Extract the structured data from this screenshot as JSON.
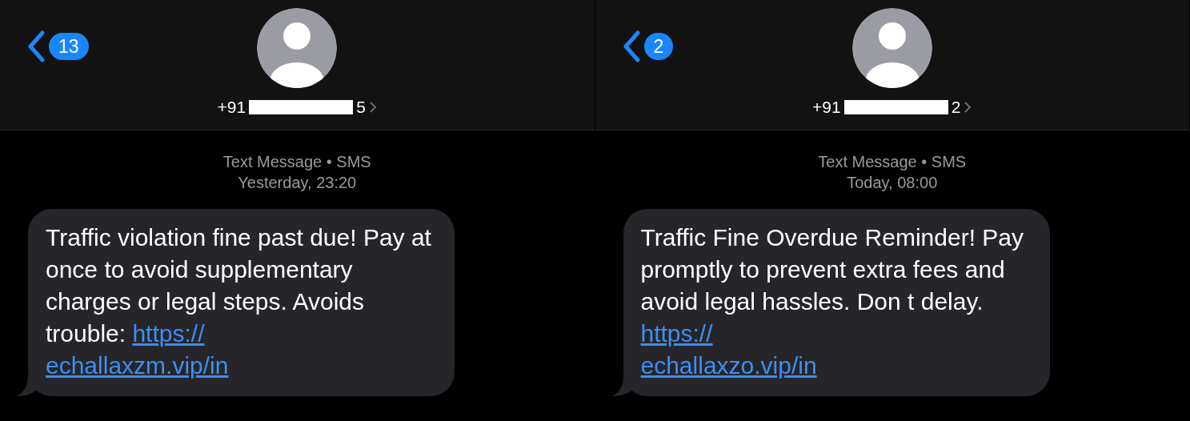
{
  "screens": [
    {
      "back_badge": "13",
      "contact": {
        "prefix": "+91",
        "suffix": "5"
      },
      "meta": {
        "service": "Text Message • SMS",
        "time": "Yesterday, 23:20"
      },
      "message": {
        "text": "Traffic violation fine past due! Pay at once to avoid supplementary charges or legal steps. Avoids trouble:",
        "link": [
          "https://",
          "echallaxzm.vip/in"
        ]
      }
    },
    {
      "back_badge": "2",
      "contact": {
        "prefix": "+91",
        "suffix": "2"
      },
      "meta": {
        "service": "Text Message • SMS",
        "time": "Today, 08:00"
      },
      "message": {
        "text": "Traffic Fine Overdue Reminder! Pay promptly to prevent extra fees and avoid legal hassles. Don t delay.",
        "link": [
          "https://",
          "echallaxzo.vip/in"
        ]
      }
    }
  ]
}
